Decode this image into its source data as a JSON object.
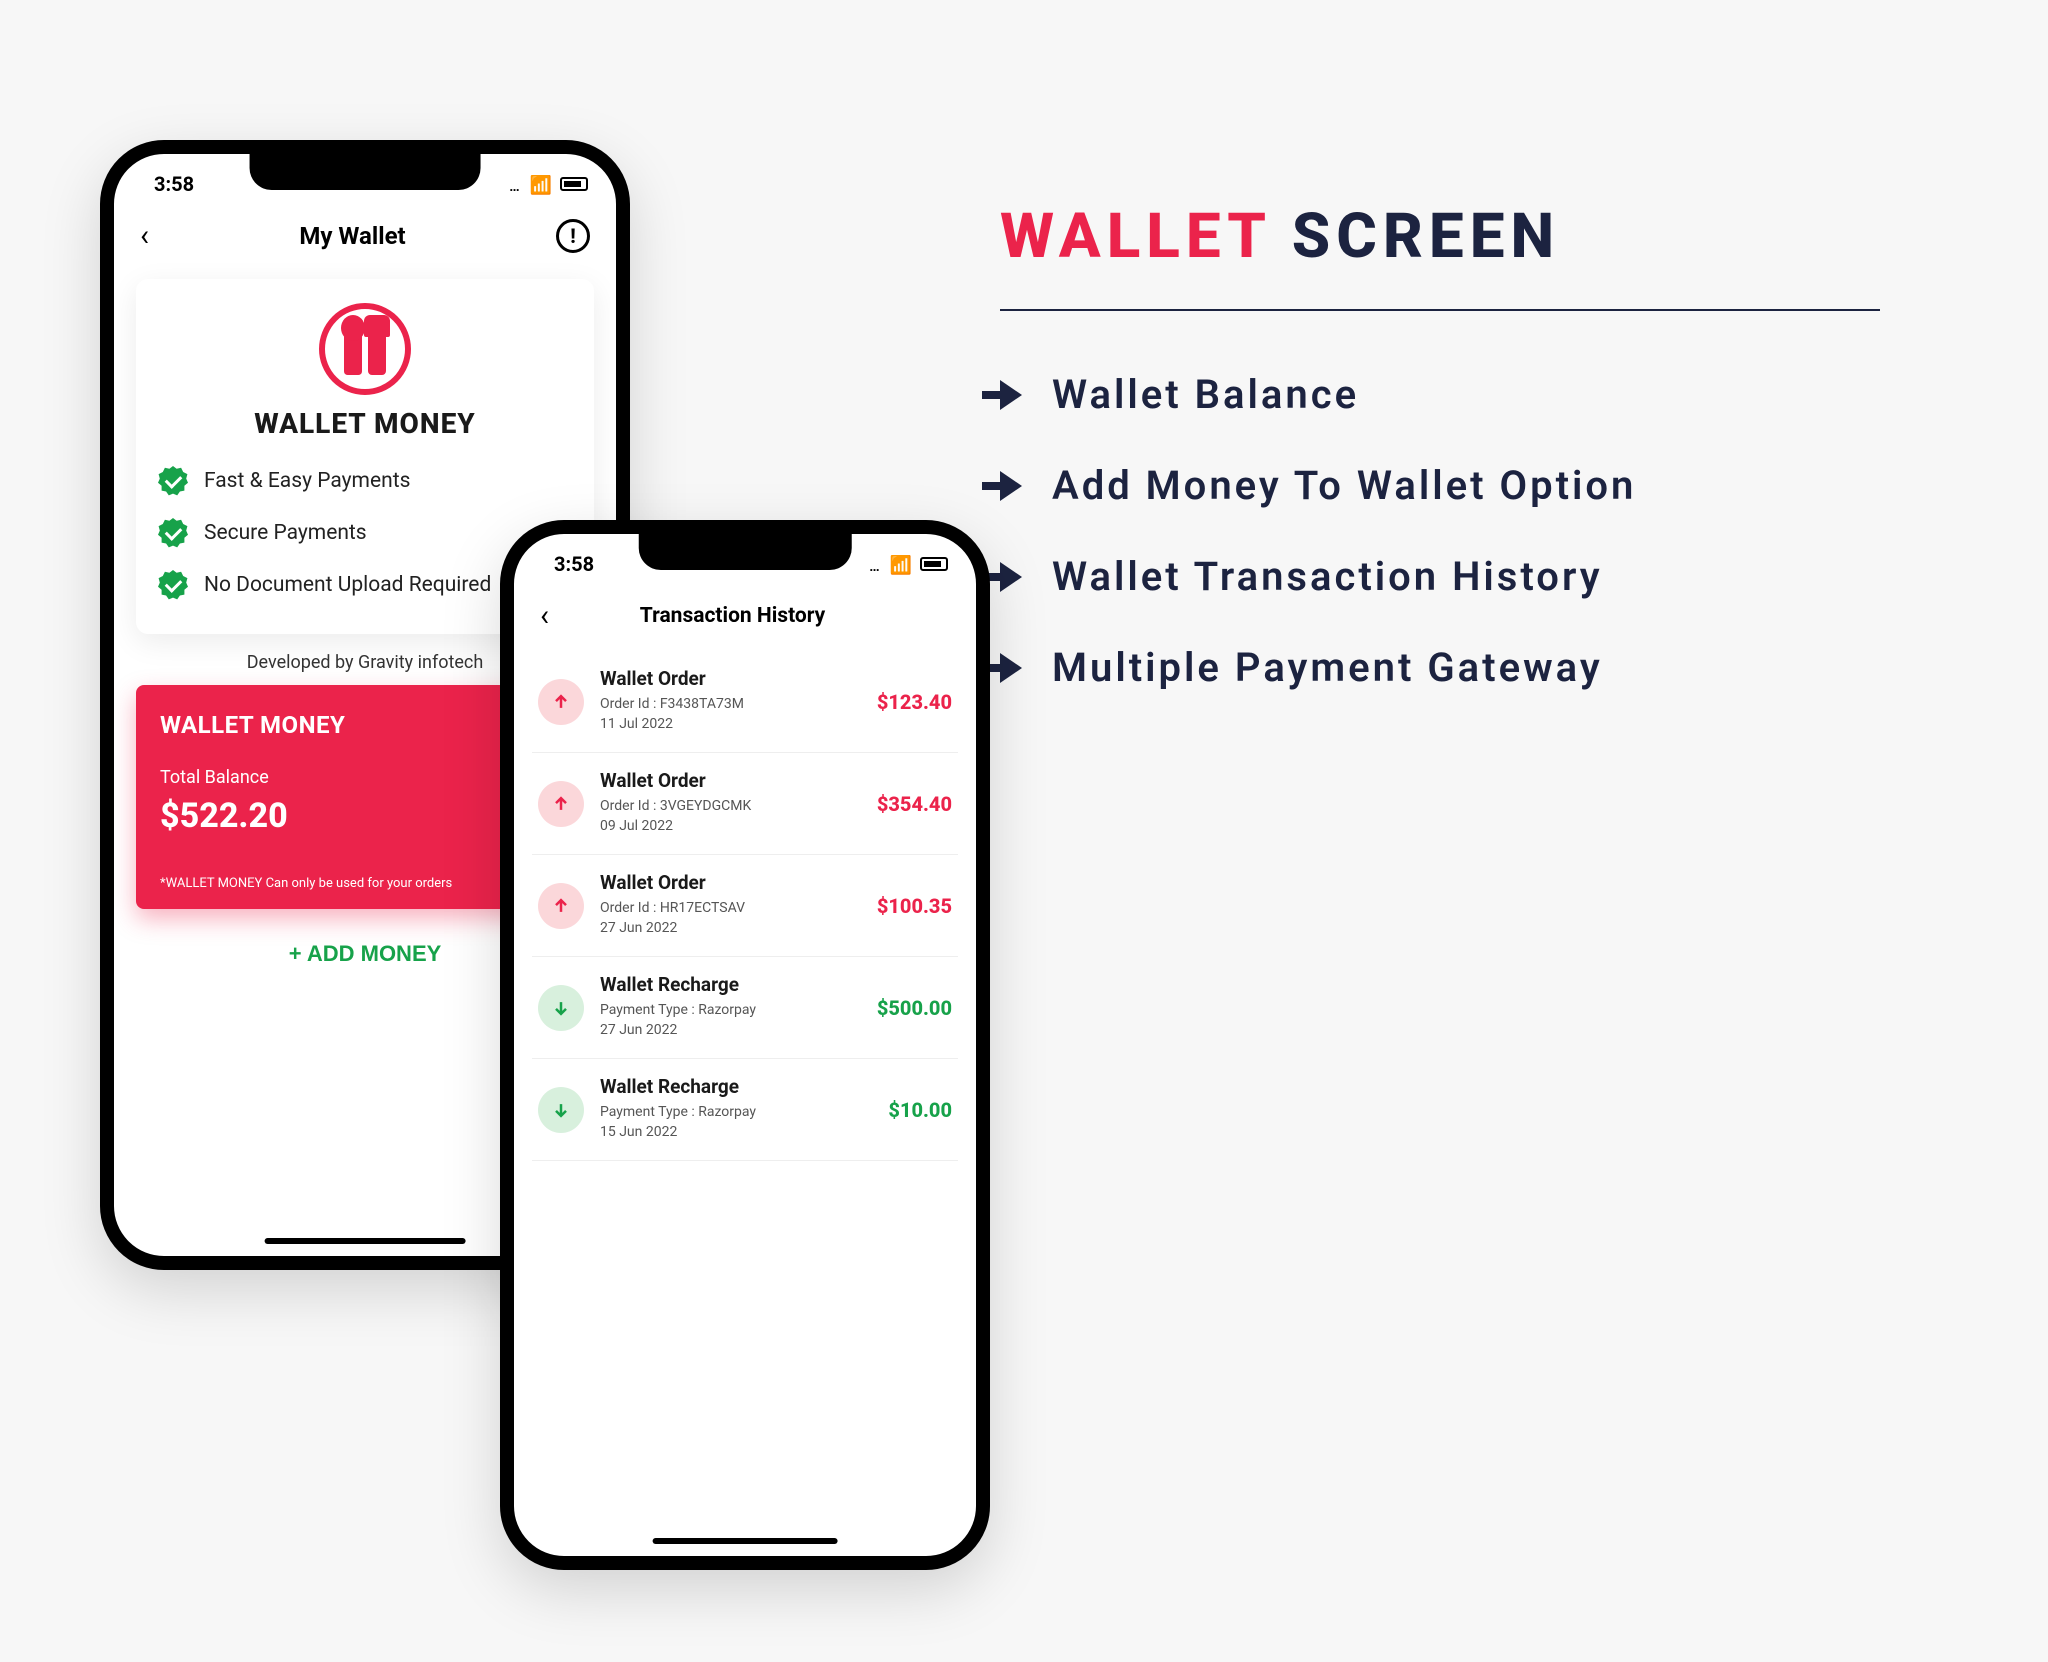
{
  "headline": {
    "accent": "WALLET",
    "rest": "SCREEN"
  },
  "features": [
    "Wallet Balance",
    "Add Money To Wallet Option",
    "Wallet Transaction History",
    "Multiple Payment Gateway"
  ],
  "status": {
    "time": "3:58"
  },
  "wallet_screen": {
    "nav_title": "My Wallet",
    "card_title": "WALLET MONEY",
    "benefits": [
      "Fast & Easy Payments",
      "Secure Payments",
      "No Document Upload Required"
    ],
    "developed_by": "Developed by Gravity infotech",
    "balance_card": {
      "title": "WALLET MONEY",
      "label": "Total Balance",
      "amount": "$522.20",
      "note": "*WALLET MONEY Can only be used for your orders"
    },
    "add_money_label": "+ ADD MONEY"
  },
  "trans_screen": {
    "nav_title": "Transaction History",
    "rows": [
      {
        "dir": "out",
        "title": "Wallet Order",
        "sub": "Order Id : F3438TA73M",
        "date": "11 Jul 2022",
        "amount": "$123.40"
      },
      {
        "dir": "out",
        "title": "Wallet Order",
        "sub": "Order Id : 3VGEYDGCMK",
        "date": "09 Jul 2022",
        "amount": "$354.40"
      },
      {
        "dir": "out",
        "title": "Wallet Order",
        "sub": "Order Id : HR17ECTSAV",
        "date": "27 Jun 2022",
        "amount": "$100.35"
      },
      {
        "dir": "in",
        "title": "Wallet Recharge",
        "sub": "Payment Type : Razorpay",
        "date": "27 Jun 2022",
        "amount": "$500.00"
      },
      {
        "dir": "in",
        "title": "Wallet Recharge",
        "sub": "Payment Type : Razorpay",
        "date": "15 Jun 2022",
        "amount": "$10.00"
      }
    ]
  }
}
